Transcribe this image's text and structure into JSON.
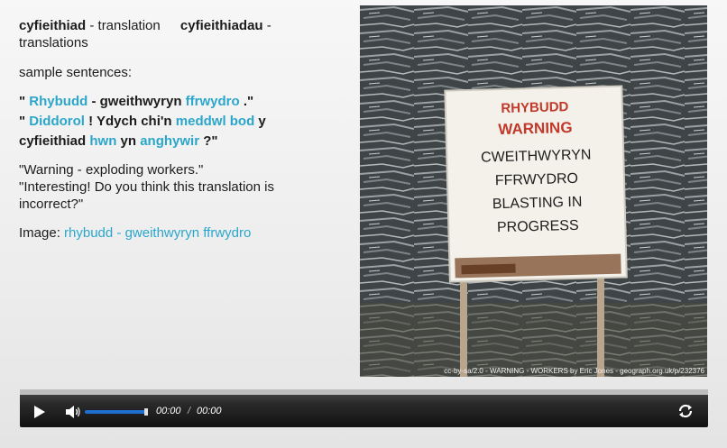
{
  "header": {
    "word": "cyfieithiad",
    "word_gloss": "- translation",
    "plural": "cyfieithiadau",
    "plural_gloss": "- translations"
  },
  "samples_label": "sample sentences:",
  "sentence1": {
    "open": "\"",
    "w1": "Rhybudd",
    "mid": " - gweithwyryn ",
    "w2": "ffrwydro",
    "end": " .\""
  },
  "sentence2": {
    "open": "\"",
    "w1": "Diddorol",
    "mid1": " ! Ydych chi'n ",
    "w2": "meddwl bod",
    "mid2": " y cyfieithiad ",
    "w3": "hwn",
    "mid3": " yn ",
    "w4": "anghywir",
    "end": " ?\""
  },
  "translation1": "\"Warning -  exploding workers.\"",
  "translation2": "\"Interesting! Do you think this translation is incorrect?\"",
  "image_line": {
    "label": "Image:",
    "link": "rhybudd - gweithwyryn ffrwydro"
  },
  "photo": {
    "sign_lines": [
      "RHYBUDD",
      "WARNING",
      "CWEITHWYRYN",
      "FFRWYDRO",
      "BLASTING IN",
      "PROGRESS"
    ],
    "credit": "cc-by-sa/2.0 - WARNING - WORKERS  by Eric Jones - geograph.org.uk/p/232376"
  },
  "player": {
    "current_time": "00:00",
    "separator": "/",
    "duration": "00:00",
    "volume_level": 1.0,
    "play_icon": "play-icon",
    "volume_icon": "volume-icon",
    "loop_icon": "loop-icon"
  }
}
